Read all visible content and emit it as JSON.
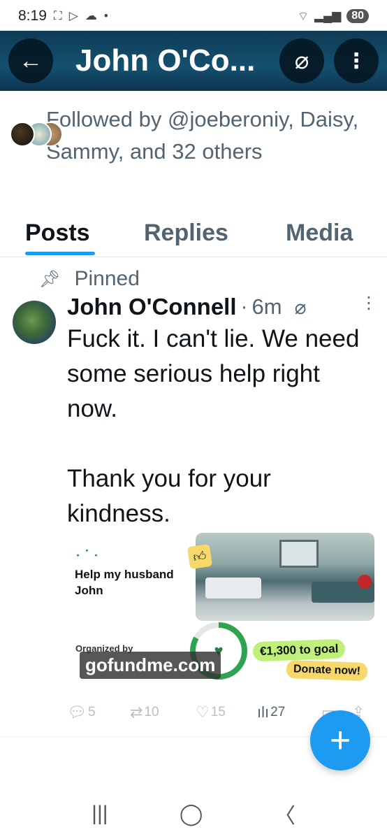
{
  "status_bar": {
    "time": "8:19",
    "battery": "80"
  },
  "header": {
    "title": "John O'Co..."
  },
  "profile": {
    "followed_by": "Followed by @joeberoniy, Daisy, Sammy, and 32 others"
  },
  "tabs": [
    {
      "label": "Posts",
      "active": true
    },
    {
      "label": "Replies",
      "active": false
    },
    {
      "label": "Media",
      "active": false
    }
  ],
  "post": {
    "pinned_label": "Pinned",
    "author": "John O'Connell",
    "separator": "·",
    "time": "6m",
    "text": "Fuck it. I can't lie. We need some serious help right now.\n\nThank you for your kindness.",
    "card": {
      "title": "Help my husband John",
      "organized_by": "Organized by",
      "goal": "€1,300 to goal",
      "cta": "Donate now!",
      "domain": "gofundme.com"
    },
    "stats": {
      "replies": "5",
      "reposts": "10",
      "likes": "15",
      "views": "27"
    }
  },
  "colors": {
    "accent": "#1d9bf0",
    "header_bg": "#14506f",
    "muted": "#536471",
    "gofundme_green": "#2ea44f"
  }
}
